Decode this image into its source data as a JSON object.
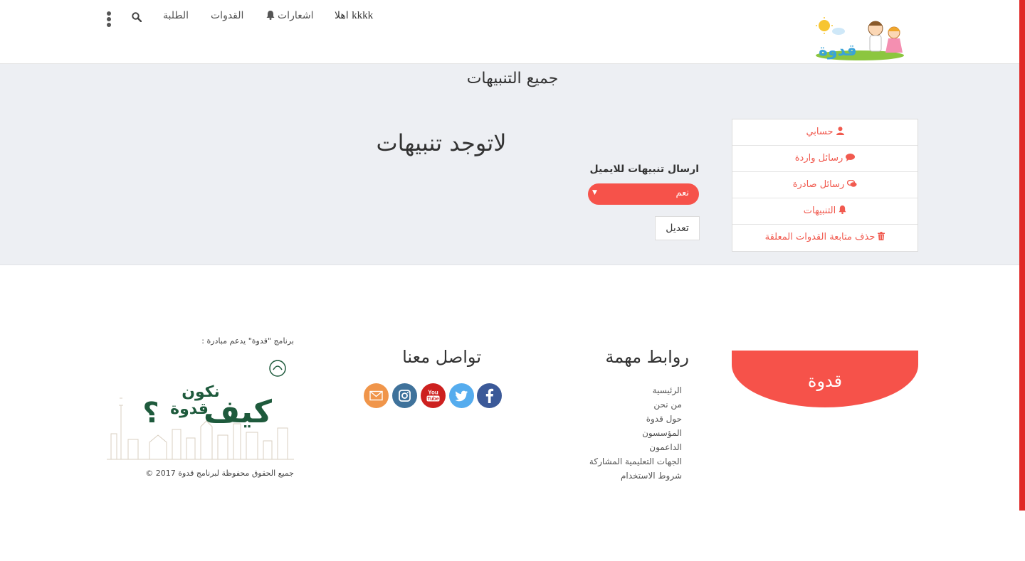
{
  "header": {
    "greeting": "اهلا",
    "username": "kkkk",
    "notifications": "اشعارات",
    "idols": "القدوات",
    "students": "الطلبة"
  },
  "main": {
    "page_title": "جميع التنبيهات",
    "empty_message": "لاتوجد تنبيهات",
    "email_label": "ارسال تنبيهات للايميل",
    "email_select_value": "نعم",
    "edit_button": "تعديل"
  },
  "side_menu": {
    "items": [
      {
        "label": "حسابي",
        "icon": "user-icon"
      },
      {
        "label": "رسائل واردة",
        "icon": "comment-icon"
      },
      {
        "label": "رسائل صادرة",
        "icon": "comments-icon"
      },
      {
        "label": "التنبيهات",
        "icon": "bell-icon"
      },
      {
        "label": "حذف متابعة القدوات المعلقة",
        "icon": "trash-icon"
      }
    ]
  },
  "footer": {
    "brand": "قدوة",
    "links_title": "روابط مهمة",
    "links": [
      "الرئيسية",
      "من نحن",
      "حول قدوة",
      "المؤسسون",
      "الداعمون",
      "الجهات التعليمية المشاركة",
      "شروط الاستخدام"
    ],
    "contact_title": "تواصل معنا",
    "support_text": "برنامج \"قدوة\" يدعم مبادرة :",
    "campaign_line1": "نكون",
    "campaign_line2": "قدوة",
    "campaign_line3": "كيف",
    "campaign_mark": "؟",
    "copyright": "جميع الحقوق محفوظة لبرنامج قدوة 2017 ©"
  },
  "colors": {
    "accent": "#f6524a",
    "accent_text": "#f15a4f",
    "main_bg": "#edeff3",
    "campaign_green": "#1e5a3c",
    "facebook": "#3b5998",
    "twitter": "#55acee",
    "youtube": "#cd201f",
    "instagram": "#3f729b",
    "email": "#f0954a"
  }
}
